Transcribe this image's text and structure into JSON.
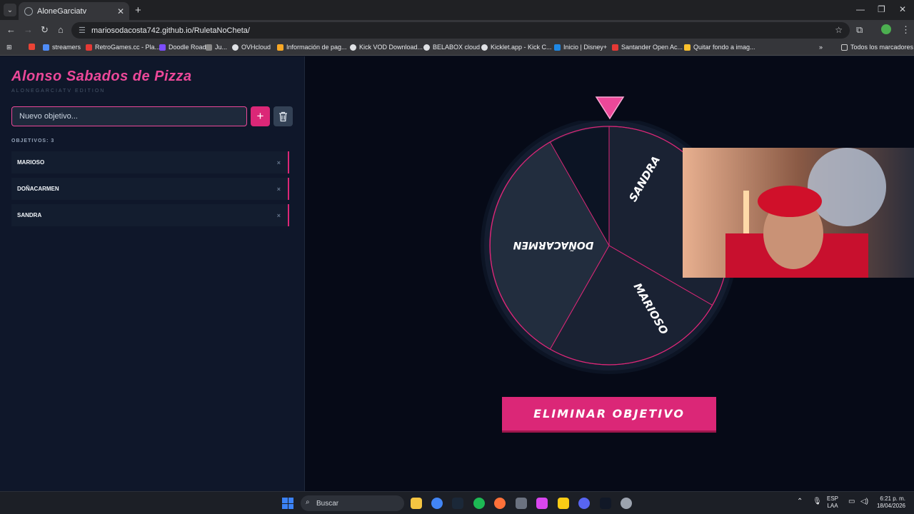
{
  "browser": {
    "tab_title": "AloneGarciatv",
    "url": "mariosodacosta742.github.io/RuletaNoCheta/",
    "bookmarks": [
      "streamers",
      "RetroGames.cc - Pla...",
      "Doodle Road",
      "Ju...",
      "OVHcloud",
      "Información de pag...",
      "Kick VOD Download...",
      "BELABOX cloud",
      "Kicklet.app - Kick C...",
      "Inicio | Disney+",
      "Santander Open Ac...",
      "Quitar fondo a imag..."
    ],
    "all_bookmarks": "Todos los marcadores"
  },
  "app": {
    "title": "Alonso Sabados de Pizza",
    "subtitle": "ALONEGARCIATV EDITION",
    "input_placeholder": "Nuevo objetivo...",
    "add_label": "+",
    "count_label": "OBJETIVOS: 3",
    "items": [
      {
        "label": "MARIOSO",
        "delete": "×"
      },
      {
        "label": "DOÑACARMEN",
        "delete": "×"
      },
      {
        "label": "SANDRA",
        "delete": "×"
      }
    ],
    "wheel_segments": [
      "SANDRA",
      "MARIOSO",
      "DOÑACARMEN"
    ],
    "action_button": "ELIMINAR OBJETIVO",
    "accent_color": "#ec4899"
  },
  "taskbar": {
    "search_placeholder": "Buscar",
    "lang_top": "ESP",
    "lang_bottom": "LAA",
    "time": "6:21 p. m.",
    "date": "18/04/2026"
  }
}
